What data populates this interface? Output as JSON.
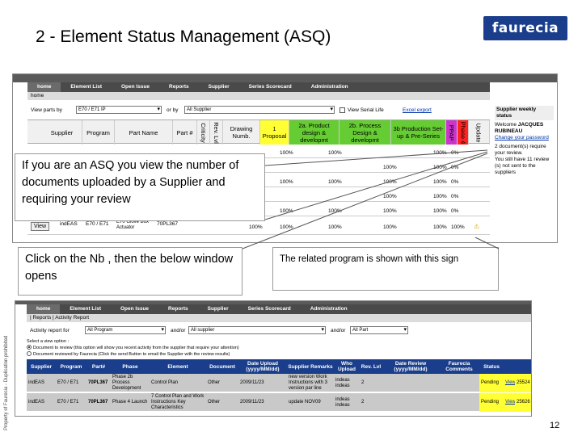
{
  "slide": {
    "title": "2 - Element Status Management  (ASQ)",
    "logo_text": "faurecia",
    "side_text": "Property of Faurecia - Duplication prohibited",
    "page_number": "12"
  },
  "screen1": {
    "nav_tabs": [
      "home",
      "Element List",
      "Open Issue",
      "Reports",
      "Supplier",
      "Series Scorecard",
      "Administration"
    ],
    "breadcrumb": "home",
    "filter": {
      "view_parts_by_label": "View parts by",
      "program_select": "E70 / E71  IP",
      "or_by_label": "or by",
      "supplier_select": "All Supplier",
      "view_serial_life_label": "View Serial Life",
      "excel_export": "Excel export"
    },
    "headers": {
      "supplier": "Supplier",
      "program": "Program",
      "part_name": "Part Name",
      "part_no": "Part #",
      "criticity": "Criticity",
      "rev_lvl": "Rev. Lvl",
      "drawing": "Drawing Numb.",
      "proposal": "1 Proposal",
      "product_design": "2a. Product design & developmt",
      "process_design": "2b. Process Design & developmt",
      "production": "3b Production Set-up & Pre-Series",
      "ppap": "PPAP",
      "phase": "Phase 4",
      "update": "Update"
    },
    "rows": [
      {
        "c1": "100%",
        "c2": "100%",
        "c3": "",
        "c4": "100%",
        "c5": "0%"
      },
      {
        "c1": "",
        "c2": "",
        "c3": "100%",
        "c4": "100%",
        "c5": "0%"
      },
      {
        "c1": "100%",
        "c2": "100%",
        "c3": "100%",
        "c4": "100%",
        "c5": "0%"
      },
      {
        "c1": "",
        "c2": "",
        "c3": "100%",
        "c4": "100%",
        "c5": "0%"
      },
      {
        "c1": "100%",
        "c2": "100%",
        "c3": "100%",
        "c4": "100%",
        "c5": "0%"
      }
    ],
    "last_row": {
      "view": "View",
      "supplier": "indEAS",
      "program": "E70 / E71",
      "part_name": "E70 Glove Box Actuator",
      "part_no": "70PL367",
      "c0": "100%",
      "c1": "100%",
      "c2": "100%",
      "c3": "100%",
      "c4": "100%",
      "c5": "100%"
    },
    "sidebar": {
      "header": "Supplier weekly status",
      "welcome": "Welcome",
      "user": "JACQUES RUBINEAU",
      "change_password": "Change your password",
      "line1": "2 document(s) require your review.",
      "line2": "You still have 11 review (s) not sent to the suppliers"
    }
  },
  "callouts": {
    "asq": "If you are an ASQ you view the number of documents uploaded by a Supplier and requiring your review",
    "click": "Click on the Nb , then the below window opens",
    "related": "The related program is shown with this sign"
  },
  "screen2": {
    "nav_tabs": [
      "home",
      "Element List",
      "Open Issue",
      "Reports",
      "Supplier",
      "Series Scorecard",
      "Administration"
    ],
    "breadcrumb": "| Reports | Activity Report",
    "filter": {
      "activity_label": "Activity report for",
      "program_select": "All Program",
      "andor1": "and/or",
      "supplier_select": "All supplier",
      "andor2": "and/or",
      "part_select": "All Part"
    },
    "radio_title": "Select a view option :",
    "radio1": "Document to review (this option will show you recent activity from the supplier that require your attention)",
    "radio2": "Document reviewed by Faurecia (Click the send Button to email the Supplier with the review results)",
    "headers": [
      "Supplier",
      "Program",
      "Part#",
      "Phase",
      "Element",
      "Document",
      "Date Upload (yyyy/MM/dd)",
      "Supplier Remarks",
      "Who Upload",
      "Rev. Lvl",
      "Date Review (yyyy/MM/dd)",
      "Faurecia Comments",
      "Status"
    ],
    "rows": [
      {
        "supplier": "indEAS",
        "program": "E70 / E71",
        "part": "70PL367",
        "phase": "Phase 2b Process Development",
        "element": "Control Plan",
        "document": "Other",
        "date_upload": "2009/11/23",
        "remarks": "new version Work Instructions with 3 version par line",
        "who": "indeas indeas",
        "rev": "2",
        "date_review": "",
        "comments": "",
        "status": "Pending",
        "view": "View",
        "id": "25524"
      },
      {
        "supplier": "indEAS",
        "program": "E70 / E71",
        "part": "70PL367",
        "phase": "Phase 4 Launch",
        "element": "7 Control Plan and Work Instructions Key Characteristics",
        "document": "Other",
        "date_upload": "2009/11/23",
        "remarks": "update NOV09",
        "who": "indeas indeas",
        "rev": "2",
        "date_review": "",
        "comments": "",
        "status": "Pending",
        "view": "View",
        "id": "25626"
      }
    ]
  },
  "colors": {
    "brand_blue": "#1a3e8c",
    "nav_dark": "#4a4a4a",
    "yellow": "#ffff33",
    "green": "#66cc33",
    "magenta": "#cc33cc",
    "red": "#ff2222"
  }
}
